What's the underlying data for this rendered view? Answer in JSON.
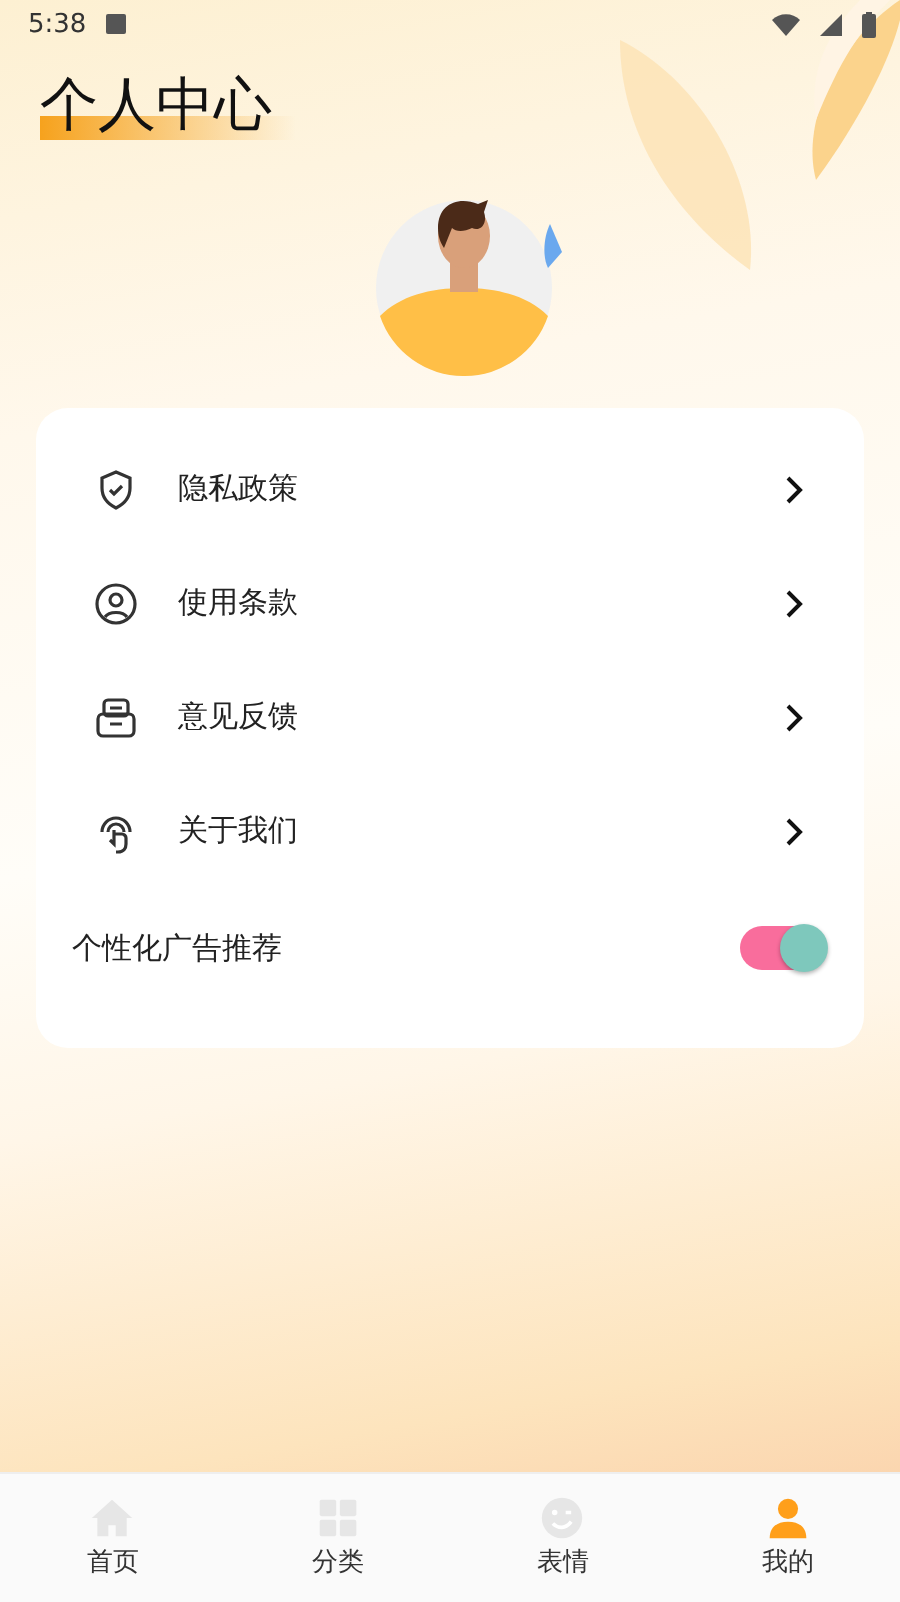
{
  "status_bar": {
    "time": "5:38"
  },
  "title": "个人中心",
  "menu": [
    {
      "label": "隐私政策",
      "kind": "shield"
    },
    {
      "label": "使用条款",
      "kind": "user"
    },
    {
      "label": "意见反馈",
      "kind": "tray"
    },
    {
      "label": "关于我们",
      "kind": "touch"
    }
  ],
  "setting": {
    "label": "个性化广告推荐",
    "on": true
  },
  "tabs": [
    {
      "label": "首页",
      "kind": "home",
      "selected": false
    },
    {
      "label": "分类",
      "kind": "grid",
      "selected": false
    },
    {
      "label": "表情",
      "kind": "smile",
      "selected": false
    },
    {
      "label": "我的",
      "kind": "person",
      "selected": true
    }
  ]
}
